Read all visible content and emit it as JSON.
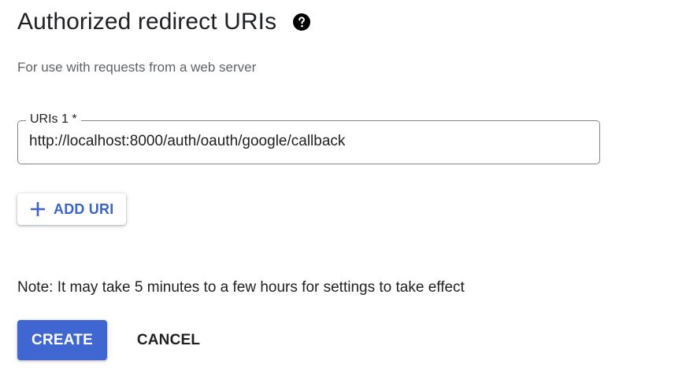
{
  "section": {
    "title": "Authorized redirect URIs",
    "help_icon": "help-circle-icon",
    "subtitle": "For use with requests from a web server"
  },
  "uri_field": {
    "label": "URIs 1 *",
    "value": "http://localhost:8000/auth/oauth/google/callback"
  },
  "add_uri": {
    "icon": "plus-icon",
    "label": "ADD URI"
  },
  "note": "Note: It may take 5 minutes to a few hours for settings to take effect",
  "actions": {
    "create_label": "CREATE",
    "cancel_label": "CANCEL"
  },
  "colors": {
    "primary": "#3f66d1",
    "link_text": "#3c63c8",
    "text": "#202124",
    "secondary_text": "#5f6368",
    "field_border": "#80868b"
  }
}
